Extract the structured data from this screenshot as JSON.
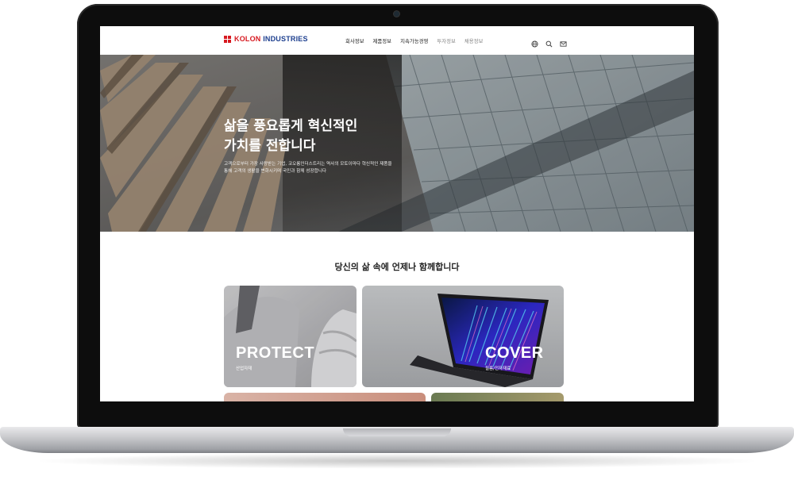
{
  "site": {
    "logo": {
      "brand": "KOLON",
      "rest": " INDUSTRIES"
    },
    "nav": [
      {
        "label": "회사정보"
      },
      {
        "label": "제품정보"
      },
      {
        "label": "지속가능경영"
      },
      {
        "label": "투자정보"
      },
      {
        "label": "채용정보"
      }
    ],
    "tools": [
      "globe-icon",
      "search-icon",
      "mail-icon"
    ]
  },
  "hero": {
    "title_line1": "삶을 풍요롭게 혁신적인",
    "title_line2": "가치를 전합니다",
    "sub_line1": "고객으로부터 가장 사랑받는 기업, 코오롱인더스트리는 역사의 모토이마다 혁신적인 제품을",
    "sub_line2": "통해 고객의 생활을 변화시키며 국민과 함께 성장합니다"
  },
  "section": {
    "title": "당신의 삶 속에 언제나 함께합니다"
  },
  "cards": [
    {
      "label": "PROTECT",
      "sub": "산업자재"
    },
    {
      "label": "COVER",
      "sub": "필름/전자재료"
    }
  ],
  "colors": {
    "brand_blue": "#1d3f8f",
    "brand_red": "#d71920"
  }
}
